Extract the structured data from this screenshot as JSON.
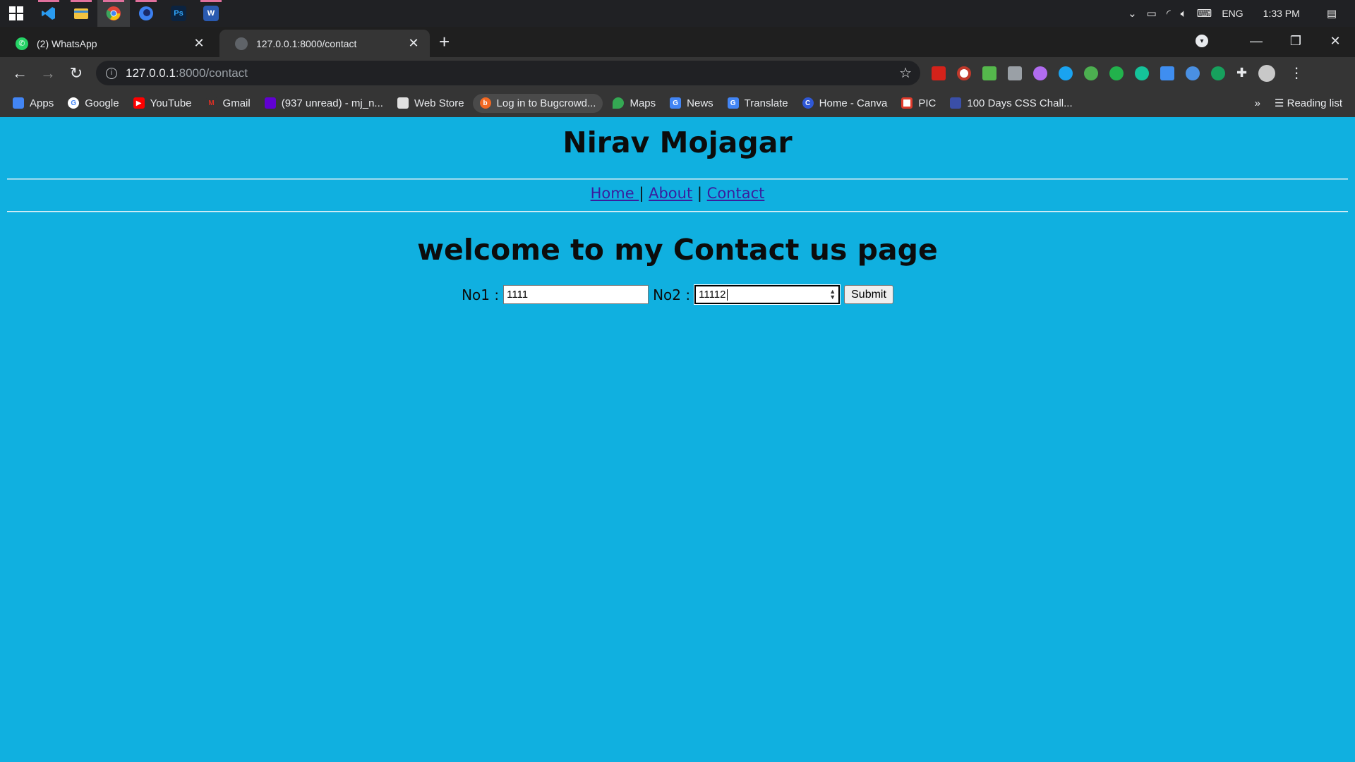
{
  "taskbar": {
    "apps": [
      {
        "name": "windows-start",
        "color": "#ffffff"
      },
      {
        "name": "vscode",
        "color": "#2a9bf0"
      },
      {
        "name": "file-explorer",
        "color": "#f2c340"
      },
      {
        "name": "chrome",
        "color": "#e0463a"
      },
      {
        "name": "firefox-dev",
        "color": "#3b7ff0"
      },
      {
        "name": "photoshop",
        "label": "Ps",
        "color": "#0b2340"
      },
      {
        "name": "word",
        "label": "W",
        "color": "#2a5ab0"
      }
    ],
    "language": "ENG",
    "time": "1:33 PM"
  },
  "tabs": [
    {
      "title": "(2) WhatsApp",
      "active": false
    },
    {
      "title": "127.0.0.1:8000/contact",
      "active": true
    }
  ],
  "address": {
    "host": "127.0.0.1",
    "path": ":8000/contact"
  },
  "bookmarks": [
    {
      "label": "Apps",
      "color": "#4285f4"
    },
    {
      "label": "Google",
      "color": "#ffffff"
    },
    {
      "label": "YouTube",
      "color": "#ff0000"
    },
    {
      "label": "Gmail",
      "color": "#d93025"
    },
    {
      "label": "(937 unread) - mj_n...",
      "color": "#6001d2"
    },
    {
      "label": "Web Store",
      "color": "#e0e0e0"
    },
    {
      "label": "Log in to Bugcrowd...",
      "color": "#f26822"
    },
    {
      "label": "Maps",
      "color": "#34a853"
    },
    {
      "label": "News",
      "color": "#4285f4"
    },
    {
      "label": "Translate",
      "color": "#4285f4"
    },
    {
      "label": "Home - Canva",
      "color": "#2f58d6"
    },
    {
      "label": "PIC",
      "color": "#e03b2c"
    },
    {
      "label": "100 Days CSS Chall...",
      "color": "#3a4fa8"
    }
  ],
  "reading_list": "Reading list",
  "page": {
    "site_title": "Nirav Mojagar",
    "nav": {
      "home": "Home ",
      "about": "About",
      "contact": "Contact",
      "sep": "|"
    },
    "heading": "welcome to my Contact us page",
    "form": {
      "no1_label": "No1 :",
      "no1_value": "1111",
      "no2_label": "No2 :",
      "no2_value": "11112",
      "submit_label": "Submit"
    }
  }
}
